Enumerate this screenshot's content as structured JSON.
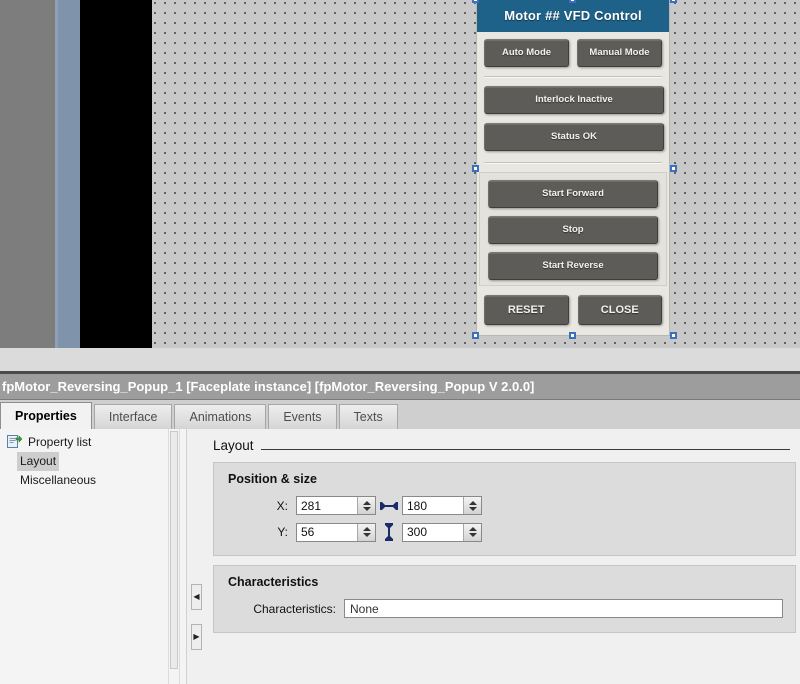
{
  "faceplate": {
    "title": "Motor ## VFD Control",
    "mode_buttons": [
      {
        "label": "Auto Mode"
      },
      {
        "label": "Manual Mode"
      }
    ],
    "status_buttons": [
      {
        "label": "Interlock Inactive"
      },
      {
        "label": "Status OK"
      }
    ],
    "command_buttons": [
      {
        "label": "Start Forward"
      },
      {
        "label": "Stop"
      },
      {
        "label": "Start Reverse"
      }
    ],
    "footer_buttons": [
      {
        "label": "RESET"
      },
      {
        "label": "CLOSE"
      }
    ],
    "colors": {
      "header_blue": "#1e6189",
      "button_gray": "#5d5c58",
      "panel_bg": "#e8e7e1",
      "selection_handle": "#3d6fbf"
    }
  },
  "panel": {
    "title": "fpMotor_Reversing_Popup_1 [Faceplate instance] [fpMotor_Reversing_Popup V 2.0.0]",
    "tabs": [
      {
        "label": "Properties",
        "active": true
      },
      {
        "label": "Interface",
        "active": false
      },
      {
        "label": "Animations",
        "active": false
      },
      {
        "label": "Events",
        "active": false
      },
      {
        "label": "Texts",
        "active": false
      }
    ],
    "tree": {
      "header": "Property list",
      "header_icon": "property-list-icon",
      "items": [
        {
          "label": "Layout",
          "selected": true
        },
        {
          "label": "Miscellaneous",
          "selected": false
        }
      ]
    },
    "content": {
      "section_title": "Layout",
      "groups": [
        {
          "title": "Position & size",
          "rows": [
            {
              "label": "X:",
              "value": "281",
              "dim_icon": "width-arrow-icon",
              "dim_value": "180"
            },
            {
              "label": "Y:",
              "value": "56",
              "dim_icon": "height-arrow-icon",
              "dim_value": "300"
            }
          ]
        },
        {
          "title": "Characteristics",
          "field_label": "Characteristics:",
          "field_value": "None"
        }
      ]
    },
    "splitter": {
      "collapse_left_icon": "◀",
      "collapse_right_icon": "▶"
    }
  }
}
